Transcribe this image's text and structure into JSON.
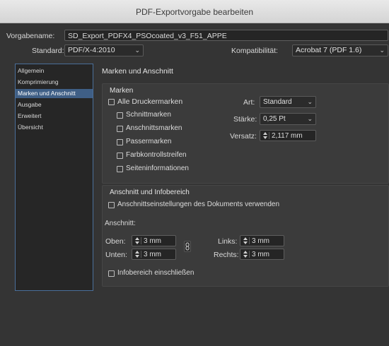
{
  "window": {
    "title": "PDF-Exportvorgabe bearbeiten"
  },
  "preset": {
    "name_label": "Vorgabename:",
    "name_value": "SD_Export_PDFX4_PSOcoated_v3_F51_APPE",
    "standard_label": "Standard:",
    "standard_value": "PDF/X-4:2010",
    "compat_label": "Kompatibilität:",
    "compat_value": "Acrobat 7 (PDF 1.6)"
  },
  "sidebar": {
    "items": [
      {
        "label": "Allgemein"
      },
      {
        "label": "Komprimierung"
      },
      {
        "label": "Marken und Anschnitt"
      },
      {
        "label": "Ausgabe"
      },
      {
        "label": "Erweitert"
      },
      {
        "label": "Übersicht"
      }
    ],
    "active_index": 2
  },
  "main": {
    "section_title": "Marken und Anschnitt",
    "marks": {
      "title": "Marken",
      "all_printer_marks": {
        "label": "Alle Druckermarken",
        "checked": false
      },
      "options": [
        {
          "label": "Schnittmarken",
          "checked": false
        },
        {
          "label": "Anschnittsmarken",
          "checked": false
        },
        {
          "label": "Passermarken",
          "checked": false
        },
        {
          "label": "Farbkontrollstreifen",
          "checked": false
        },
        {
          "label": "Seiteninformationen",
          "checked": false
        }
      ],
      "type_label": "Art:",
      "type_value": "Standard",
      "weight_label": "Stärke:",
      "weight_value": "0,25 Pt",
      "offset_label": "Versatz:",
      "offset_value": "2,117 mm"
    },
    "bleed": {
      "title": "Anschnitt und Infobereich",
      "use_doc_settings": {
        "label": "Anschnittseinstellungen des Dokuments verwenden",
        "checked": false
      },
      "bleed_label": "Anschnitt:",
      "top_label": "Oben:",
      "top_value": "3 mm",
      "bottom_label": "Unten:",
      "bottom_value": "3 mm",
      "left_label": "Links:",
      "left_value": "3 mm",
      "right_label": "Rechts:",
      "right_value": "3 mm",
      "include_slug": {
        "label": "Infobereich einschließen",
        "checked": false
      }
    }
  },
  "colors": {
    "accent": "#3f5f86",
    "background": "#343434",
    "panel": "#3b3b3b"
  }
}
